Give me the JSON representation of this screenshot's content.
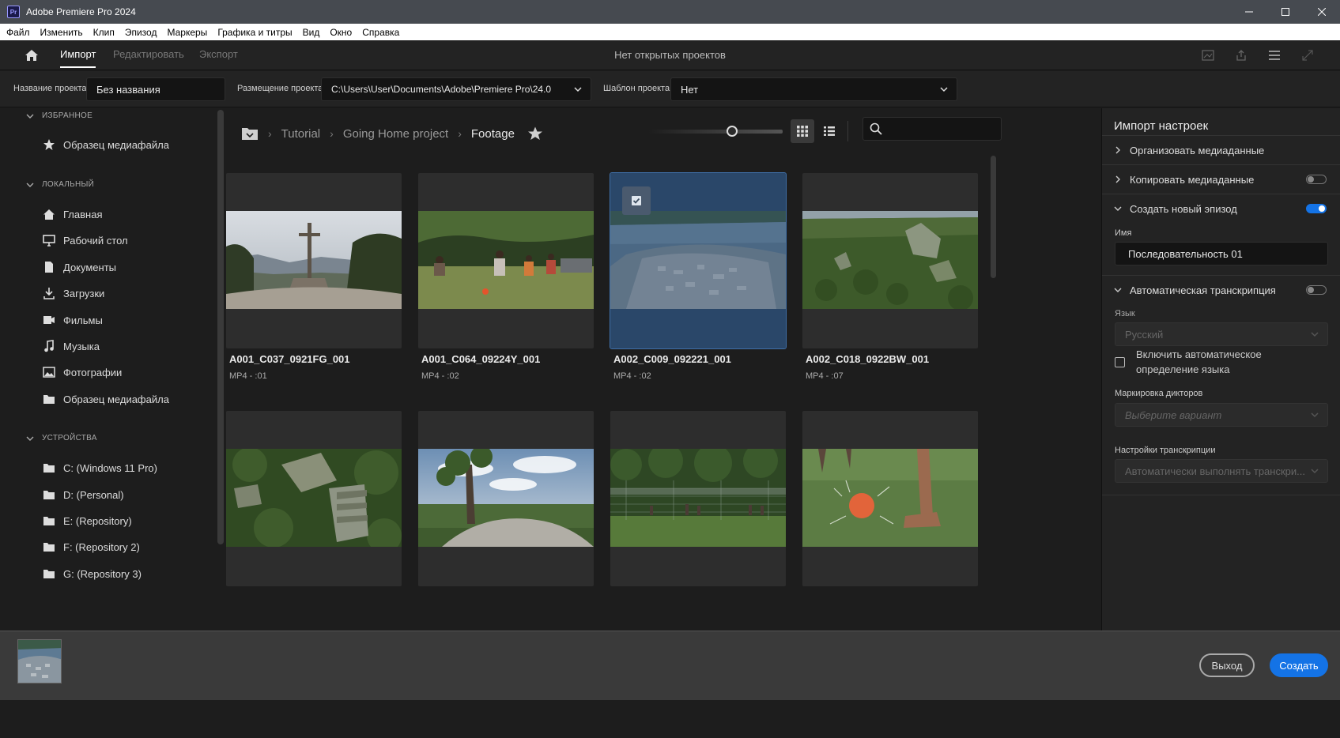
{
  "window": {
    "app_icon": "Pr",
    "title": "Adobe Premiere Pro 2024",
    "buttons": [
      "minimize-icon",
      "maximize-icon",
      "close-icon"
    ]
  },
  "menu": [
    "Файл",
    "Изменить",
    "Клип",
    "Эпизод",
    "Маркеры",
    "Графика и титры",
    "Вид",
    "Окно",
    "Справка"
  ],
  "header": {
    "tabs": [
      "Импорт",
      "Редактировать",
      "Экспорт"
    ],
    "active_tab": "Импорт",
    "center_text": "Нет открытых проектов"
  },
  "project_bar": {
    "name_label": "Название проекта",
    "name_value": "Без названия",
    "location_label": "Размещение проекта",
    "location_value": "C:\\Users\\User\\Documents\\Adobe\\Premiere Pro\\24.0",
    "template_label": "Шаблон проекта",
    "template_value": "Нет"
  },
  "sidebar": {
    "favorites_label": "ИЗБРАННОЕ",
    "favorites": [
      {
        "label": "Образец медиафайла",
        "icon": "star-icon"
      }
    ],
    "local_label": "ЛОКАЛЬНЫЙ",
    "local": [
      {
        "label": "Главная",
        "icon": "home-icon"
      },
      {
        "label": "Рабочий стол",
        "icon": "monitor-icon"
      },
      {
        "label": "Документы",
        "icon": "document-icon"
      },
      {
        "label": "Загрузки",
        "icon": "download-icon"
      },
      {
        "label": "Фильмы",
        "icon": "film-icon"
      },
      {
        "label": "Музыка",
        "icon": "music-icon"
      },
      {
        "label": "Фотографии",
        "icon": "photo-icon"
      },
      {
        "label": "Образец медиафайла",
        "icon": "folder-icon"
      }
    ],
    "devices_label": "УСТРОЙСТВА",
    "devices": [
      {
        "label": "C: (Windows 11 Pro)",
        "icon": "folder-icon"
      },
      {
        "label": "D: (Personal)",
        "icon": "folder-icon"
      },
      {
        "label": "E: (Repository)",
        "icon": "folder-icon"
      },
      {
        "label": "F: (Repository 2)",
        "icon": "folder-icon"
      },
      {
        "label": "G: (Repository 3)",
        "icon": "folder-icon"
      }
    ]
  },
  "browser": {
    "breadcrumb": [
      "Tutorial",
      "Going Home project",
      "Footage"
    ],
    "search_placeholder": "",
    "clips": [
      {
        "name": "A001_C037_0921FG_001",
        "meta": "MP4 - :01",
        "selected": false
      },
      {
        "name": "A001_C064_09224Y_001",
        "meta": "MP4 - :02",
        "selected": false
      },
      {
        "name": "A002_C009_092221_001",
        "meta": "MP4 - :02",
        "selected": true
      },
      {
        "name": "A002_C018_0922BW_001",
        "meta": "MP4 - :07",
        "selected": false
      },
      {
        "name": "",
        "meta": "",
        "selected": false
      },
      {
        "name": "",
        "meta": "",
        "selected": false
      },
      {
        "name": "",
        "meta": "",
        "selected": false
      },
      {
        "name": "",
        "meta": "",
        "selected": false
      }
    ]
  },
  "import_settings": {
    "title": "Импорт настроек",
    "organize": "Организовать медиаданные",
    "copy": "Копировать медиаданные",
    "copy_on": false,
    "new_sequence": "Создать новый эпизод",
    "new_sequence_on": true,
    "name_label": "Имя",
    "name_value": "Последовательность 01",
    "auto_transcribe": "Автоматическая транскрипция",
    "auto_transcribe_on": false,
    "language_label": "Язык",
    "language_value": "Русский",
    "auto_detect": "Включить автоматическое определение языка",
    "speaker_label": "Маркировка дикторов",
    "speaker_value": "Выберите вариант",
    "transcription_label": "Настройки транскрипции",
    "transcription_value": "Автоматически выполнять транскри..."
  },
  "footer": {
    "exit": "Выход",
    "create": "Создать"
  },
  "colors": {
    "accent": "#1473e6",
    "selection": "#2a4769"
  }
}
